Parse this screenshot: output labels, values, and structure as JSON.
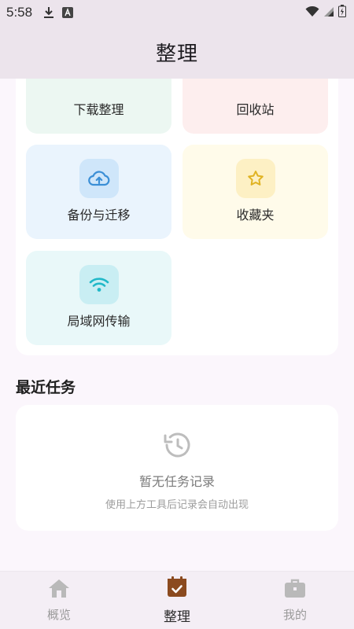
{
  "status_bar": {
    "time": "5:58"
  },
  "app_bar": {
    "title": "整理"
  },
  "tools": [
    {
      "label": "下载整理",
      "icon": "download-icon",
      "color": "#3f9a78"
    },
    {
      "label": "回收站",
      "icon": "trash-icon",
      "color": "#e05a5a"
    },
    {
      "label": "备份与迁移",
      "icon": "cloud-upload-icon",
      "color": "#3b8fd6"
    },
    {
      "label": "收藏夹",
      "icon": "star-icon",
      "color": "#e0b323"
    },
    {
      "label": "局域网传输",
      "icon": "wifi-icon",
      "color": "#20b8c8"
    }
  ],
  "recent": {
    "title": "最近任务",
    "empty_title": "暂无任务记录",
    "empty_subtitle": "使用上方工具后记录会自动出现",
    "icon": "history-icon"
  },
  "bottom_nav": [
    {
      "label": "概览",
      "icon": "home-icon",
      "active": false
    },
    {
      "label": "整理",
      "icon": "calendar-check-icon",
      "active": true,
      "color": "#8b4a1f"
    },
    {
      "label": "我的",
      "icon": "briefcase-icon",
      "active": false
    }
  ]
}
